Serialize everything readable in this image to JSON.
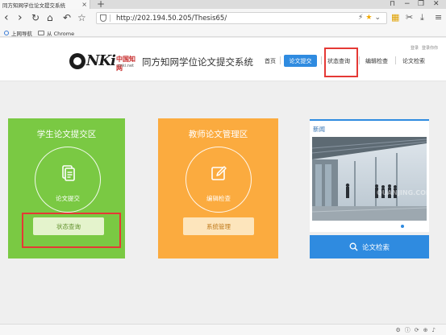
{
  "browser": {
    "tab_title": "同方知网学位论文提交系统",
    "tab_close": "×",
    "new_tab": "+",
    "url": "http://202.194.50.205/Thesis65/",
    "window_controls": {
      "pin": "⊓",
      "minimize": "−",
      "restore": "❐",
      "close": "✕"
    },
    "nav_icons": {
      "back": "‹",
      "forward": "›",
      "reload": "↻",
      "home": "⌂",
      "undo": "↶",
      "favorite": "☆"
    },
    "toolbar_icons": {
      "apps": "▦",
      "cut": "✂",
      "download": "⤓",
      "menu": "≡"
    }
  },
  "bookmarks": [
    {
      "label": "上网导航",
      "icon": "globe-icon"
    },
    {
      "label": "从 Chrome",
      "icon": "folder-icon"
    }
  ],
  "header": {
    "top_links": [
      "登录",
      "登录你你"
    ],
    "logo_sub": "中国知网",
    "logo_net": "cnki.net",
    "logo_mark": "NKi",
    "system_title": "同方知网学位论文提交系统",
    "nav": {
      "home": "首页",
      "submit": "论文提交",
      "status": "状态查询",
      "edit_check": "编辑检查",
      "search": "论文检索"
    }
  },
  "student_zone": {
    "title": "学生论文提交区",
    "circle_label": "论文提交",
    "button": "状态查询"
  },
  "teacher_zone": {
    "title": "教师论文管理区",
    "circle_label": "编辑检查",
    "button": "系统管理"
  },
  "news": {
    "title": "新闻",
    "watermark": "QUANJING.COM"
  },
  "search_button": "论文检索",
  "colors": {
    "green_card": "#7ac943",
    "orange_card": "#fbab3f",
    "primary_blue": "#2f8be0",
    "highlight_red": "#e53935"
  }
}
